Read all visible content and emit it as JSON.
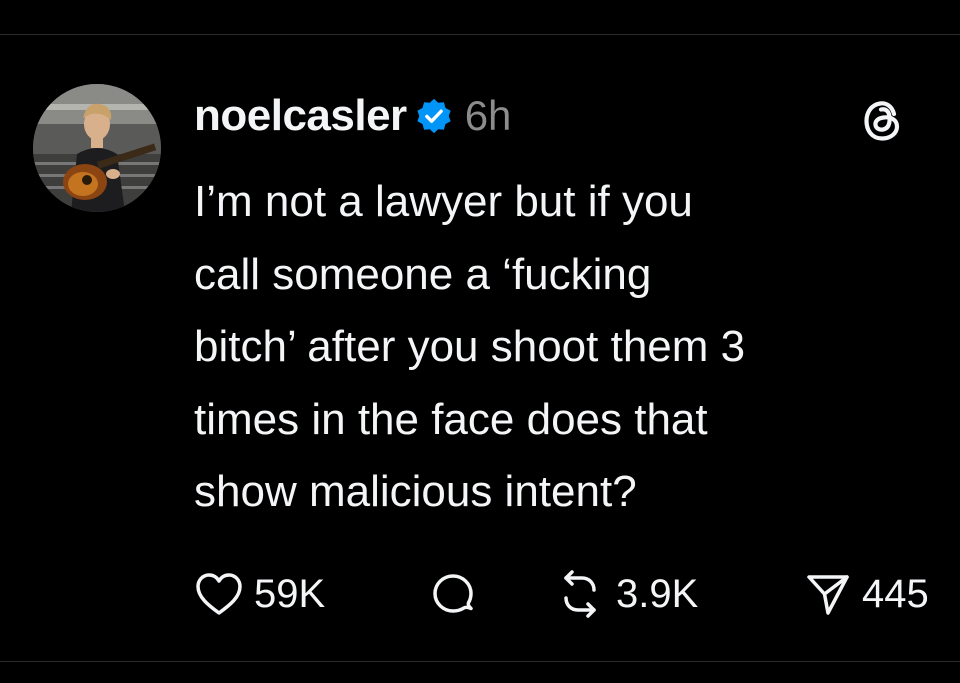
{
  "post": {
    "username": "noelcasler",
    "verified": true,
    "timestamp": "6h",
    "text": "I’m not a lawyer but if you\ncall someone a ‘fucking\nbitch’ after you shoot them 3\ntimes in the face does that\nshow malicious intent?",
    "likes": "59K",
    "reposts": "3.9K",
    "shares": "445"
  },
  "icons": {
    "avatar": "profile-photo",
    "verified": "verified-badge-icon",
    "logo": "threads-logo-icon",
    "like": "heart-icon",
    "reply": "comment-bubble-icon",
    "repost": "repost-icon",
    "share": "send-icon"
  },
  "colors": {
    "background": "#000000",
    "text": "#f3f5f7",
    "muted": "#8c8c8c",
    "verified": "#0095f6"
  }
}
